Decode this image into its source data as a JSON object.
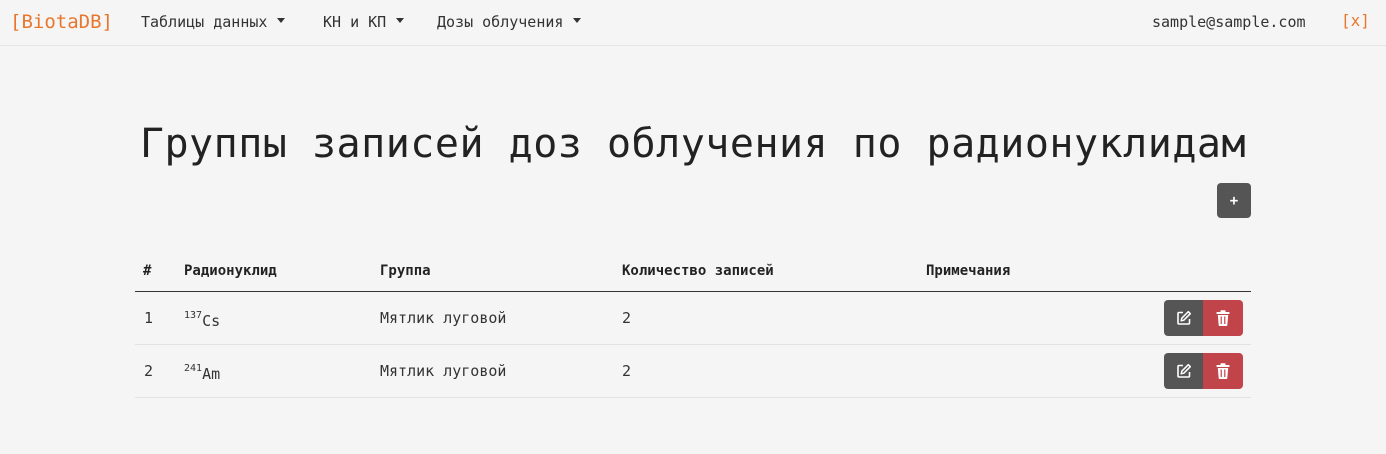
{
  "navbar": {
    "brand": "[BiotaDB]",
    "menus": [
      {
        "label": "Таблицы данных"
      },
      {
        "label": "КН и КП"
      },
      {
        "label": "Дозы облучения"
      }
    ],
    "user_email": "sample@sample.com",
    "logout_label": "[x]"
  },
  "page": {
    "title": "Группы записей доз облучения по радионуклидам",
    "add_button_label": "+"
  },
  "table": {
    "headers": [
      "#",
      "Радионуклид",
      "Группа",
      "Количество записей",
      "Примечания"
    ],
    "rows": [
      {
        "num": "1",
        "nuclide_mass": "137",
        "nuclide_symbol": "Cs",
        "group": "Мятлик луговой",
        "count": "2",
        "notes": ""
      },
      {
        "num": "2",
        "nuclide_mass": "241",
        "nuclide_symbol": "Am",
        "group": "Мятлик луговой",
        "count": "2",
        "notes": ""
      }
    ]
  },
  "colors": {
    "accent": "#e8772e",
    "button_dark": "#555555",
    "button_danger": "#c0444a",
    "background": "#f5f5f5"
  },
  "icons": {
    "edit": "edit-icon",
    "delete": "trash-icon"
  }
}
